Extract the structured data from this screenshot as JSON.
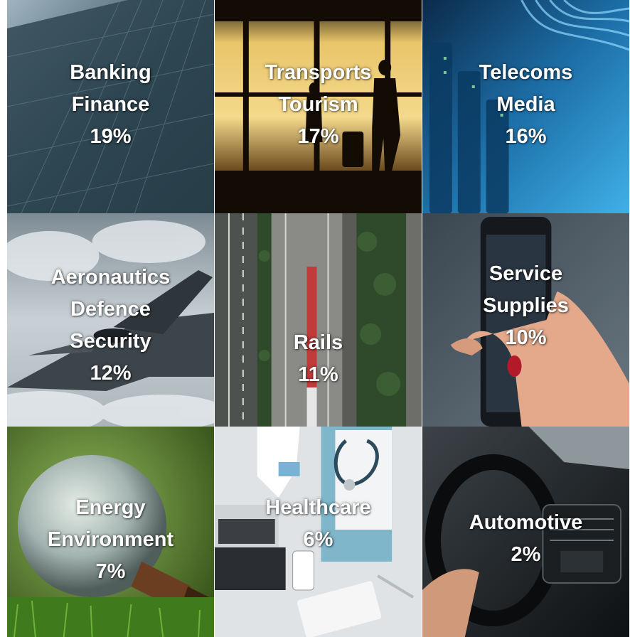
{
  "tiles": [
    {
      "lines": [
        "Banking",
        "Finance",
        "19%"
      ],
      "image": "office-tower-photo"
    },
    {
      "lines": [
        "Transports",
        "Tourism",
        "17%"
      ],
      "image": "airport-traveler-photo"
    },
    {
      "lines": [
        "Telecoms",
        "Media",
        "16%"
      ],
      "image": "server-cables-photo"
    },
    {
      "lines": [
        "Aeronautics",
        "Defence",
        "Security",
        "12%"
      ],
      "image": "fighter-jet-photo"
    },
    {
      "lines": [
        "Rails",
        "11%"
      ],
      "image": "train-aerial-photo"
    },
    {
      "lines": [
        "Service",
        "Supplies",
        "10%"
      ],
      "image": "smartphone-hand-photo"
    },
    {
      "lines": [
        "Energy",
        "Environment",
        "7%"
      ],
      "image": "light-bulb-grass-photo"
    },
    {
      "lines": [
        "Healthcare",
        "6%"
      ],
      "image": "doctor-desk-photo"
    },
    {
      "lines": [
        "Automotive",
        "2%"
      ],
      "image": "car-dashboard-photo"
    }
  ]
}
